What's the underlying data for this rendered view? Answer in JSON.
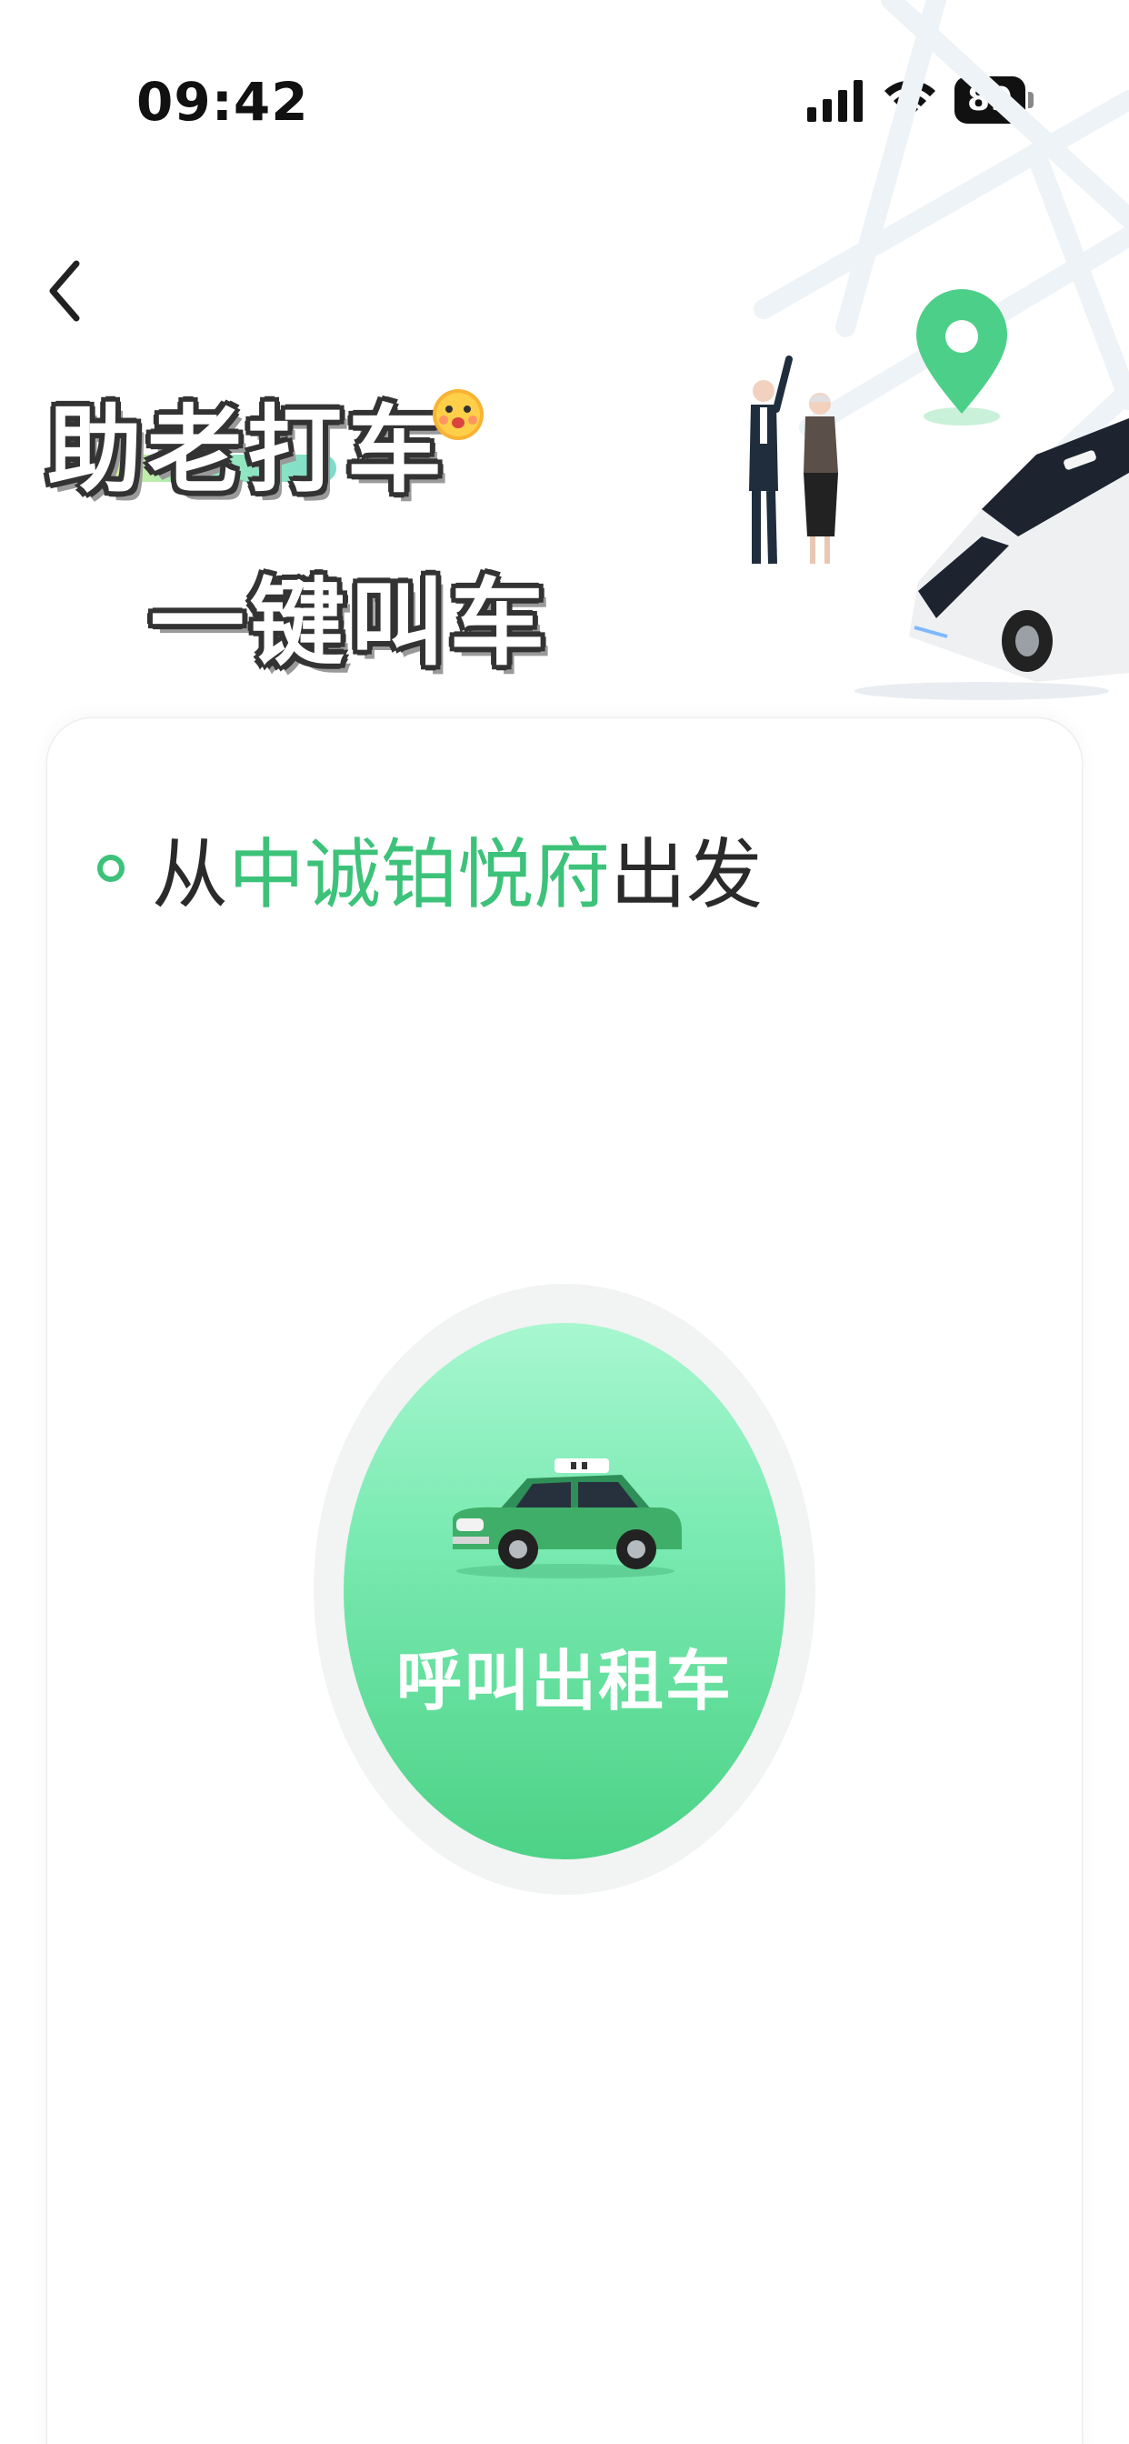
{
  "status_bar": {
    "time": "09:42",
    "battery": "89",
    "icons": [
      "signal-icon",
      "wifi-icon",
      "battery-icon"
    ]
  },
  "header": {
    "back_icon": "chevron-left-icon",
    "title_line1": "助老打车",
    "title_line2": "一键叫车",
    "decorations": [
      "emoji-icon",
      "elderly-couple-illustration",
      "map-pin-icon",
      "car-illustration"
    ]
  },
  "origin": {
    "prefix": "从",
    "place": "中诚铂悦府",
    "suffix": "出发"
  },
  "call_button": {
    "label": "呼叫出租车",
    "icon": "taxi-icon"
  },
  "colors": {
    "accent": "#3dc27a",
    "button_top": "#a8f7d0",
    "button_bottom": "#4cd286"
  }
}
